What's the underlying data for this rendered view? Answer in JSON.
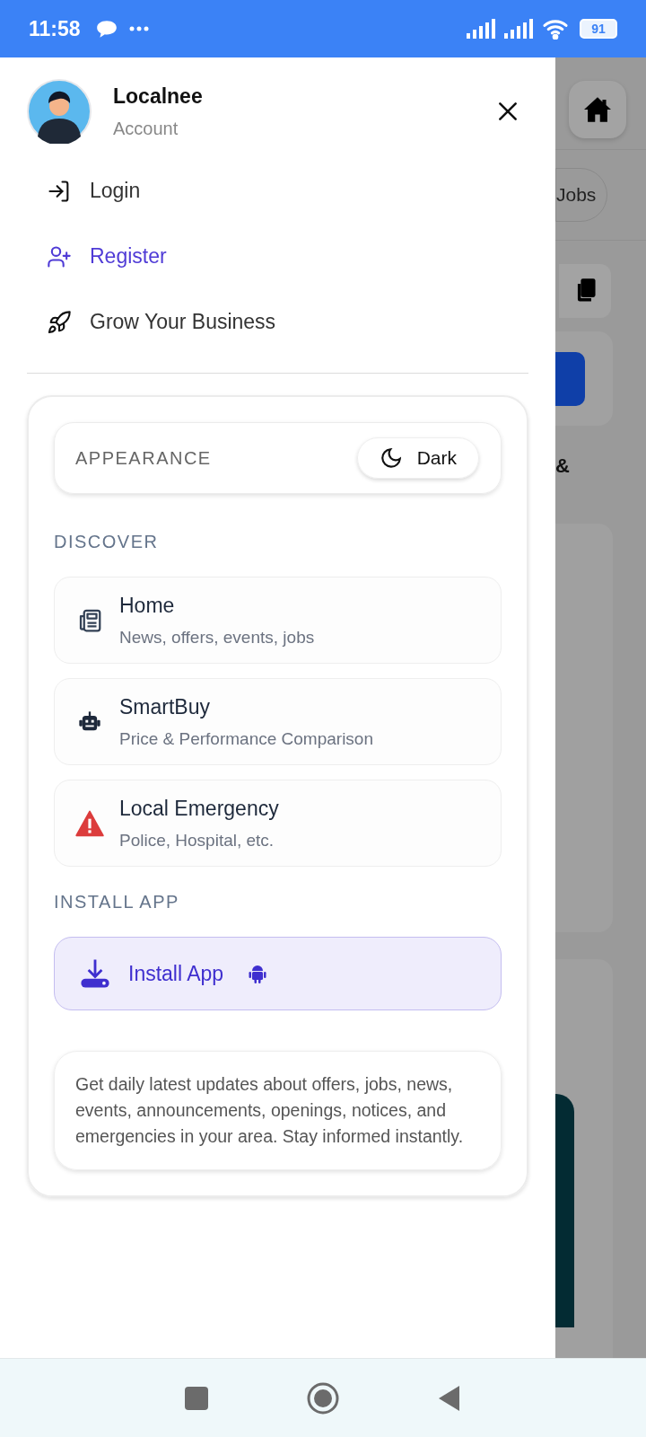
{
  "status_bar": {
    "time": "11:58",
    "battery": "91"
  },
  "drawer": {
    "account": {
      "name": "Localnee",
      "subtitle": "Account"
    },
    "menu": [
      {
        "kind": "login",
        "label": "Login",
        "selected": false
      },
      {
        "kind": "register",
        "label": "Register",
        "selected": true
      },
      {
        "kind": "grow",
        "label": "Grow Your Business",
        "selected": false
      }
    ],
    "appearance": {
      "label": "APPEARANCE",
      "button": "Dark"
    },
    "discover": {
      "heading": "DISCOVER",
      "items": [
        {
          "kind": "news",
          "title": "Home",
          "subtitle": "News, offers, events, jobs"
        },
        {
          "kind": "robot",
          "title": "SmartBuy",
          "subtitle": "Price & Performance Comparison"
        },
        {
          "kind": "alert",
          "title": "Local Emergency",
          "subtitle": "Police, Hospital, etc."
        }
      ]
    },
    "install": {
      "heading": "INSTALL APP",
      "button": "Install App"
    },
    "info": "Get daily latest updates about offers, jobs, news, events, announcements, openings, notices, and emergencies in your area. Stay informed instantly."
  },
  "background": {
    "chip": "Jobs",
    "glyph": "&"
  }
}
